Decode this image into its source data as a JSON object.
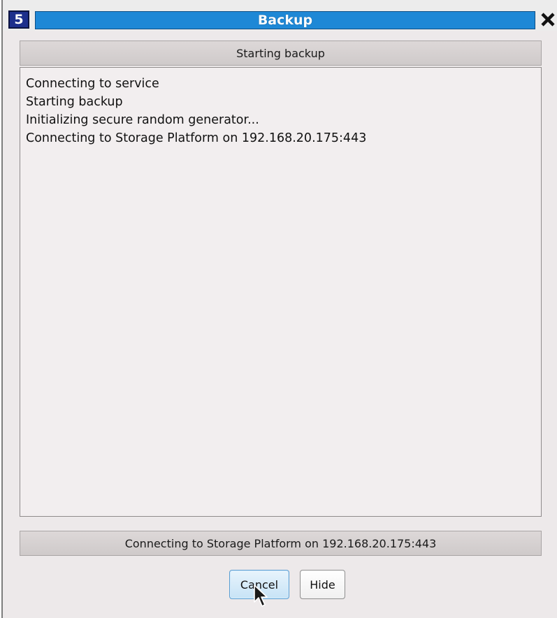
{
  "window": {
    "title": "Backup",
    "app_icon_label": "5",
    "close_icon": "close-icon"
  },
  "header": {
    "label": "Starting backup"
  },
  "log": {
    "lines": [
      "Connecting to service",
      "Starting backup",
      "Initializing secure random generator...",
      "Connecting to Storage Platform on 192.168.20.175:443"
    ]
  },
  "status": {
    "label": "Connecting to Storage Platform on 192.168.20.175:443"
  },
  "buttons": {
    "cancel_label": "Cancel",
    "hide_label": "Hide"
  },
  "colors": {
    "title_bar": "#1e88d6",
    "window_bg": "#ede9ea",
    "focused_button_border": "#5a9ed2"
  }
}
